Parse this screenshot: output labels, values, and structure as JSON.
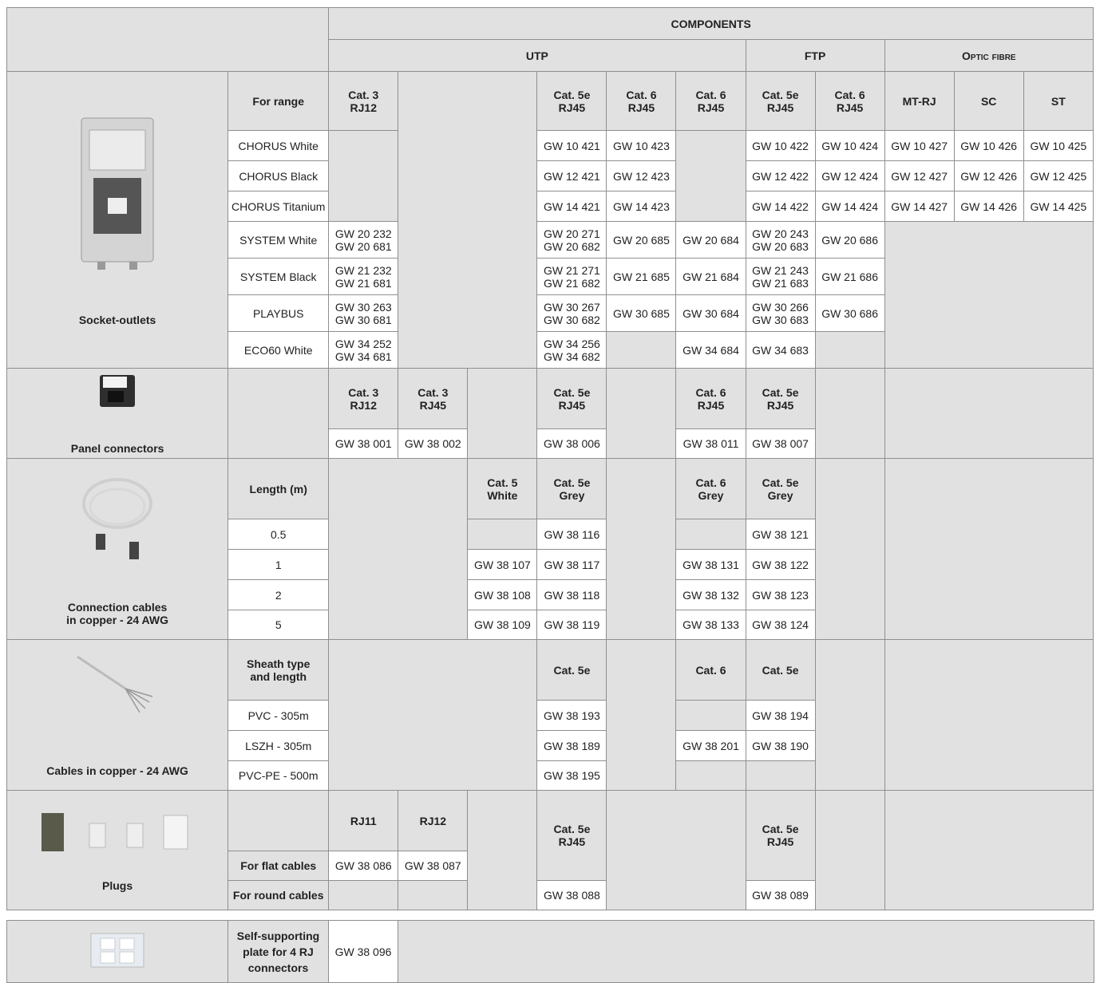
{
  "header": {
    "components": "COMPONENTS",
    "utp": "UTP",
    "ftp": "FTP",
    "optic": "Optic fibre"
  },
  "socket": {
    "label": "Socket-outlets",
    "range_label": "For range",
    "cats": [
      "Cat. 3\nRJ12",
      "Cat. 5e\nRJ45",
      "Cat. 6\nRJ45",
      "Cat. 6\nRJ45",
      "Cat. 5e\nRJ45",
      "Cat. 6\nRJ45",
      "MT-RJ",
      "SC",
      "ST"
    ],
    "rows": [
      {
        "name": "CHORUS White",
        "c5e": "GW 10 421",
        "c6": "GW 10 423",
        "f5e": "GW 10 422",
        "f6": "GW 10 424",
        "mtrj": "GW 10 427",
        "sc": "GW 10 426",
        "st": "GW 10 425"
      },
      {
        "name": "CHORUS Black",
        "c5e": "GW 12 421",
        "c6": "GW 12 423",
        "f5e": "GW 12 422",
        "f6": "GW 12 424",
        "mtrj": "GW 12 427",
        "sc": "GW 12 426",
        "st": "GW 12 425"
      },
      {
        "name": "CHORUS Titanium",
        "c5e": "GW 14 421",
        "c6": "GW 14 423",
        "f5e": "GW 14 422",
        "f6": "GW 14 424",
        "mtrj": "GW 14 427",
        "sc": "GW 14 426",
        "st": "GW 14 425"
      },
      {
        "name": "SYSTEM White",
        "c3": "GW 20 232\nGW 20 681",
        "c5e": "GW 20 271\nGW 20 682",
        "c6": "GW 20 685",
        "c6b": "GW 20 684",
        "f5e": "GW 20 243\nGW 20 683",
        "f6": "GW 20 686"
      },
      {
        "name": "SYSTEM Black",
        "c3": "GW 21 232\nGW 21 681",
        "c5e": "GW 21 271\nGW 21 682",
        "c6": "GW 21 685",
        "c6b": "GW 21 684",
        "f5e": "GW 21 243\nGW 21 683",
        "f6": "GW 21 686"
      },
      {
        "name": "PLAYBUS",
        "c3": "GW 30 263\nGW 30 681",
        "c5e": "GW 30 267\nGW 30 682",
        "c6": "GW 30 685",
        "c6b": "GW 30 684",
        "f5e": "GW 30 266\nGW 30 683",
        "f6": "GW 30 686"
      },
      {
        "name": "ECO60 White",
        "c3": "GW 34 252\nGW 34 681",
        "c5e": "GW 34 256\nGW 34 682",
        "c6b": "GW 34 684",
        "f5e": "GW 34 683"
      }
    ]
  },
  "panel": {
    "label": "Panel connectors",
    "cats": [
      "Cat. 3\nRJ12",
      "Cat. 3\nRJ45",
      "Cat. 5e\nRJ45",
      "Cat. 6\nRJ45",
      "Cat. 5e\nRJ45"
    ],
    "codes": [
      "GW 38 001",
      "GW 38 002",
      "GW 38 006",
      "GW 38 011",
      "GW 38 007"
    ]
  },
  "conn_cables": {
    "label": "Connection cables\nin copper - 24 AWG",
    "length_label": "Length (m)",
    "cats": [
      "Cat. 5\nWhite",
      "Cat. 5e\nGrey",
      "Cat. 6\nGrey",
      "Cat. 5e\nGrey"
    ],
    "rows": [
      {
        "len": "0.5",
        "c5": "",
        "c5e": "GW 38 116",
        "c6": "",
        "f5e": "GW 38 121"
      },
      {
        "len": "1",
        "c5": "GW 38 107",
        "c5e": "GW 38 117",
        "c6": "GW 38 131",
        "f5e": "GW 38 122"
      },
      {
        "len": "2",
        "c5": "GW 38 108",
        "c5e": "GW 38 118",
        "c6": "GW 38 132",
        "f5e": "GW 38 123"
      },
      {
        "len": "5",
        "c5": "GW 38 109",
        "c5e": "GW 38 119",
        "c6": "GW 38 133",
        "f5e": "GW 38 124"
      }
    ]
  },
  "cables": {
    "label": "Cables in copper - 24 AWG",
    "sheath_label": "Sheath type\nand length",
    "cats": [
      "Cat. 5e",
      "Cat. 6",
      "Cat. 5e"
    ],
    "rows": [
      {
        "name": "PVC - 305m",
        "c5e": "GW 38 193",
        "c6": "",
        "f5e": "GW 38 194"
      },
      {
        "name": "LSZH - 305m",
        "c5e": "GW 38 189",
        "c6": "GW 38 201",
        "f5e": "GW 38 190"
      },
      {
        "name": "PVC-PE - 500m",
        "c5e": "GW 38 195",
        "c6": "",
        "f5e": ""
      }
    ]
  },
  "plugs": {
    "label": "Plugs",
    "cats": [
      "RJ11",
      "RJ12",
      "Cat. 5e\nRJ45",
      "Cat. 5e\nRJ45"
    ],
    "flat_label": "For flat cables",
    "round_label": "For round cables",
    "flat": [
      "GW 38 086",
      "GW 38 087"
    ],
    "round": [
      "GW 38 088",
      "GW 38 089"
    ]
  },
  "plate": {
    "label": "Self-supporting\nplate for 4 RJ\nconnectors",
    "code": "GW 38 096"
  },
  "colors": {
    "header_bg": "#e1e1e1",
    "border": "#8f8f8f"
  }
}
